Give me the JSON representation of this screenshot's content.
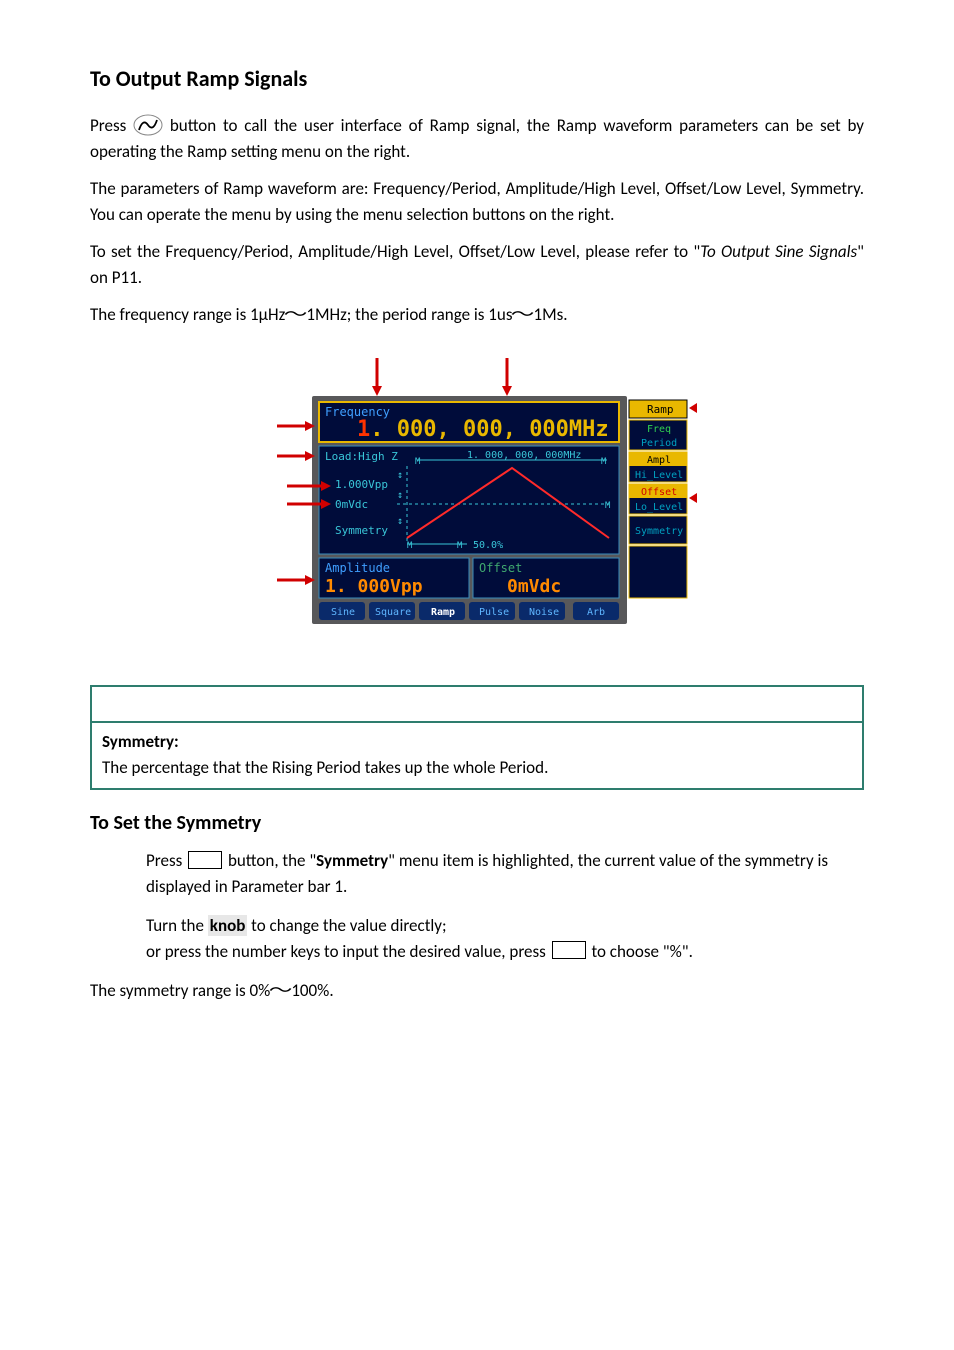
{
  "title": "To Output Ramp Signals",
  "para1a": "Press ",
  "para1b": " button to call the user interface of Ramp signal, the Ramp waveform parameters can be set by operating the Ramp setting menu on the right.",
  "para2": "The parameters of Ramp waveform are: Frequency/Period, Amplitude/High Level, Offset/Low Level, Symmetry. You can operate the menu by using the menu selection buttons on the right.",
  "para3a": "To set the Frequency/Period, Amplitude/High Level, Offset/Low Level, please refer to \"",
  "para3_italic": "To Output Sine Signals",
  "para3b": "\" on P11.",
  "para4a": "The frequency range is 1μHz",
  "para4b": "1MHz; the period range is 1us",
  "para4c": "1Ms.",
  "tilde": "～",
  "device": {
    "freq_label": "Frequency",
    "freq_value": "1. 000, 000, 000MHz",
    "load_label": "Load:High Z",
    "x_axis_label": "1. 000, 000, 000MHz",
    "vpp_label": "1.000Vpp",
    "dc_label": "0mVdc",
    "sym_label": "Symmetry",
    "sym_value": "50.0%",
    "amp_label": "Amplitude",
    "amp_value": "1. 000Vpp",
    "off_label": "Offset",
    "off_value": "0mVdc",
    "menu": {
      "header": "Ramp",
      "items": [
        "Freq",
        "Period",
        "Ampl",
        "Hi_Level",
        "Offset",
        "Lo_Level",
        "Symmetry"
      ]
    },
    "tabs": [
      "Sine",
      "Square",
      "Ramp",
      "Pulse",
      "Noise",
      "Arb"
    ]
  },
  "glossary": {
    "term": "Symmetry:",
    "desc": "The percentage that the Rising Period takes up the whole Period."
  },
  "sub_heading": "To Set the Symmetry",
  "step1a": "Press ",
  "step1b": " button, the \"",
  "step1_bold": "Symmetry",
  "step1c": "\" menu item is highlighted, the current value of the symmetry is displayed in Parameter bar 1.",
  "step2a": "Turn the ",
  "step2_knob": "knob",
  "step2b": " to change the value directly;",
  "step2c": "or press the number keys to input the desired value, press ",
  "step2d": " to choose \"%\".",
  "final_a": "The symmetry range is 0%",
  "final_b": "100%."
}
